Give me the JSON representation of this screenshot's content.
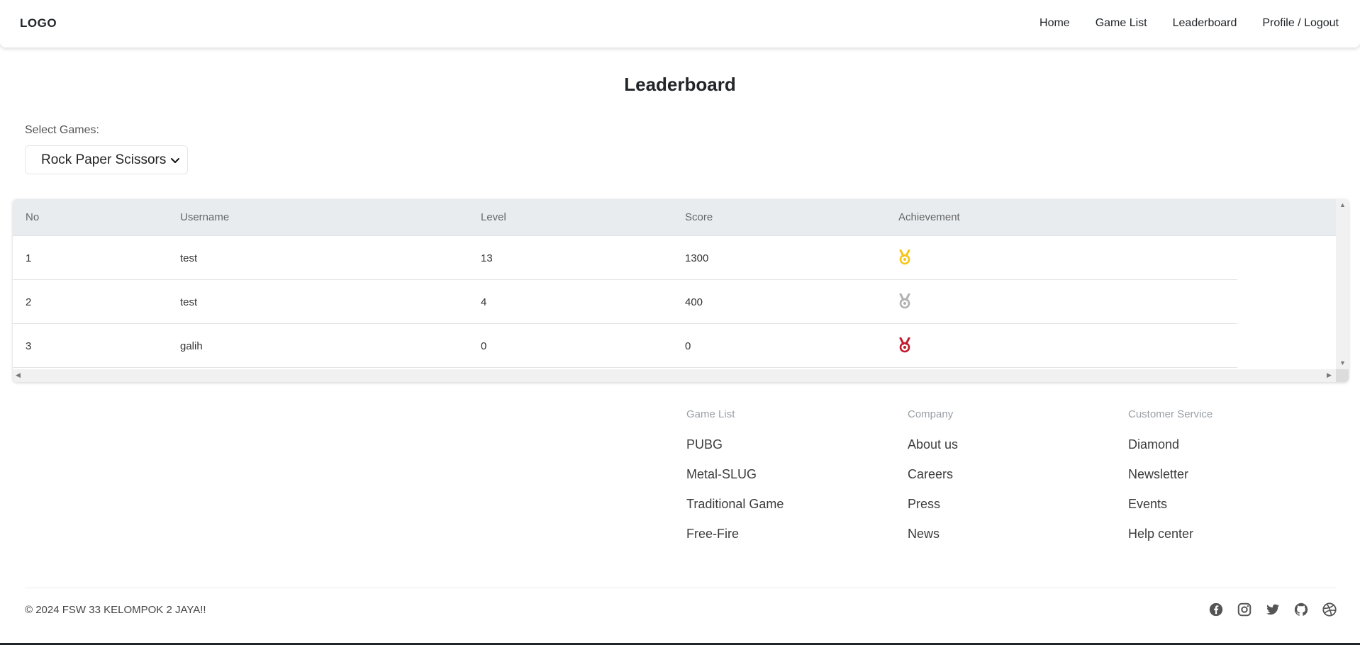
{
  "navbar": {
    "logo": "LOGO",
    "links": [
      "Home",
      "Game List",
      "Leaderboard",
      "Profile / Logout"
    ]
  },
  "page": {
    "title": "Leaderboard"
  },
  "game_select": {
    "label": "Select Games:",
    "selected": "Rock Paper Scissors"
  },
  "table": {
    "headers": [
      "No",
      "Username",
      "Level",
      "Score",
      "Achievement"
    ],
    "rows": [
      {
        "no": "1",
        "username": "test",
        "level": "13",
        "score": "1300",
        "achievement": "gold-medal-icon"
      },
      {
        "no": "2",
        "username": "test",
        "level": "4",
        "score": "400",
        "achievement": "silver-medal-icon"
      },
      {
        "no": "3",
        "username": "galih",
        "level": "0",
        "score": "0",
        "achievement": "bronze-medal-icon"
      }
    ]
  },
  "colors": {
    "gold": "#f5c518",
    "silver": "#b0b0b0",
    "bronze": "#c0182b"
  },
  "footer": {
    "columns": [
      {
        "heading": "Game List",
        "links": [
          "PUBG",
          "Metal-SLUG",
          "Traditional Game",
          "Free-Fire"
        ]
      },
      {
        "heading": "Company",
        "links": [
          "About us",
          "Careers",
          "Press",
          "News"
        ]
      },
      {
        "heading": "Customer Service",
        "links": [
          "Diamond",
          "Newsletter",
          "Events",
          "Help center"
        ]
      }
    ],
    "copyright": "© 2024 FSW 33 KELOMPOK 2 JAYA!!",
    "socials": [
      "facebook-icon",
      "instagram-icon",
      "twitter-icon",
      "github-icon",
      "dribbble-icon"
    ]
  }
}
